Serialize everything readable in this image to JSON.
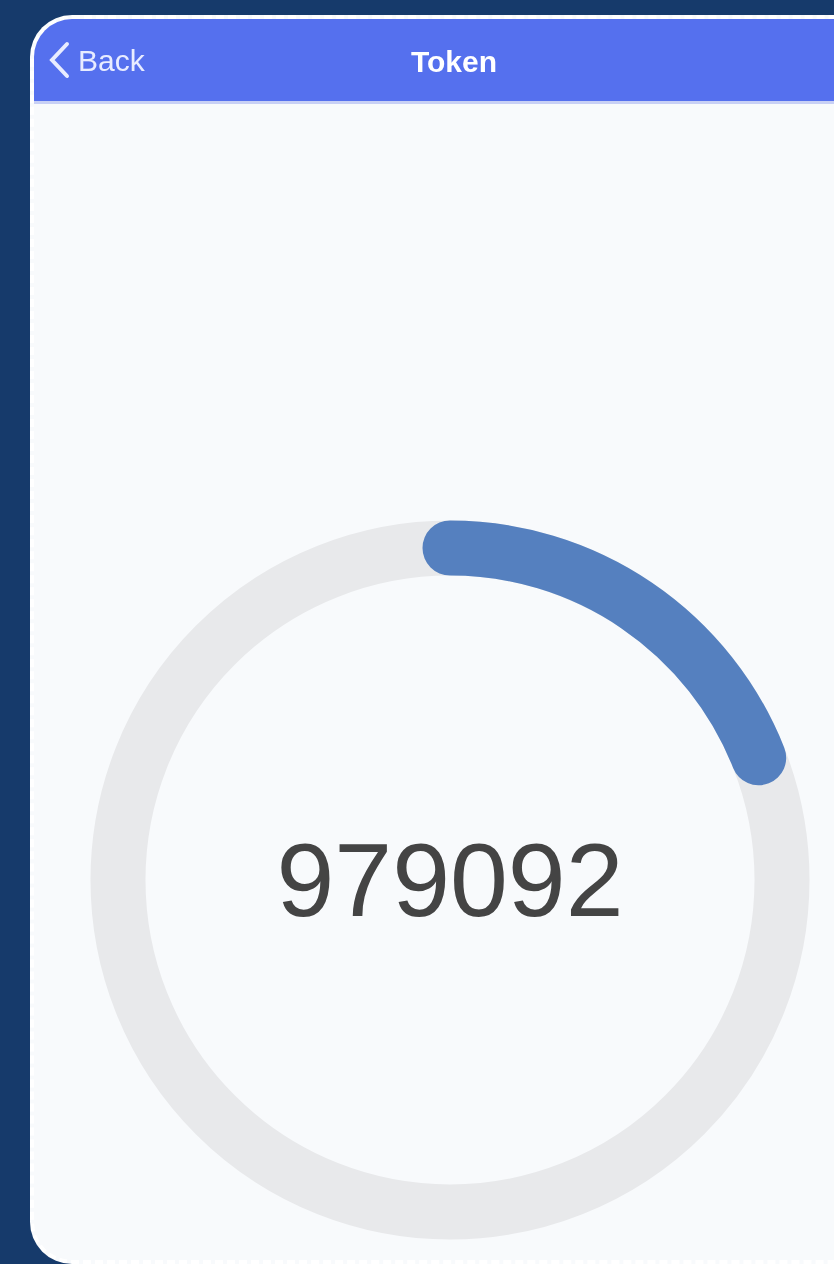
{
  "header": {
    "back_label": "Back",
    "title": "Token"
  },
  "token": {
    "code": "979092"
  }
}
